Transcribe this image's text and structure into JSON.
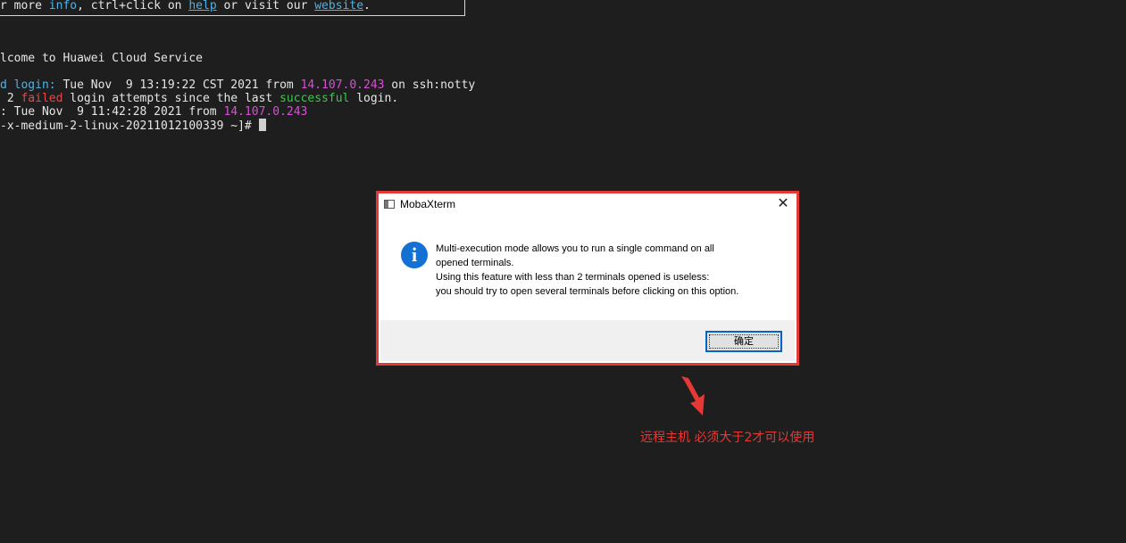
{
  "terminal": {
    "banner": {
      "prefix": "r more ",
      "info": "info",
      "mid1": ", ctrl+click on ",
      "help": "help",
      "mid2": " or visit our ",
      "website": "website",
      "suffix": "."
    },
    "welcome": "lcome to Huawei Cloud Service",
    "last_login": {
      "label": "d login:",
      "text": " Tue Nov  9 13:19:22 CST 2021 from ",
      "ip": "14.107.0.243",
      "suffix": " on ssh:notty"
    },
    "failed_line": {
      "count": " 2 ",
      "failed": "failed",
      "mid": " login attempts since the last ",
      "successful": "successful",
      "suffix": " login."
    },
    "last_success": {
      "text": ": Tue Nov  9 11:42:28 2021 from ",
      "ip": "14.107.0.243"
    },
    "prompt": "-x-medium-2-linux-20211012100339 ~]# "
  },
  "dialog": {
    "title": "MobaXterm",
    "close_glyph": "✕",
    "info_glyph": "i",
    "message_lines": [
      "Multi-execution mode allows you to run a single command on all",
      "opened terminals.",
      "Using this feature with less than 2 terminals opened is useless:",
      "you should try to open several terminals before clicking on this option."
    ],
    "ok_label": "确定"
  },
  "annotation": {
    "text": "远程主机 必须大于2才可以使用",
    "color": "#e53935"
  },
  "colors": {
    "terminal_bg": "#1e1e1e",
    "highlight": "#e53935",
    "info_blue": "#1570d4"
  }
}
